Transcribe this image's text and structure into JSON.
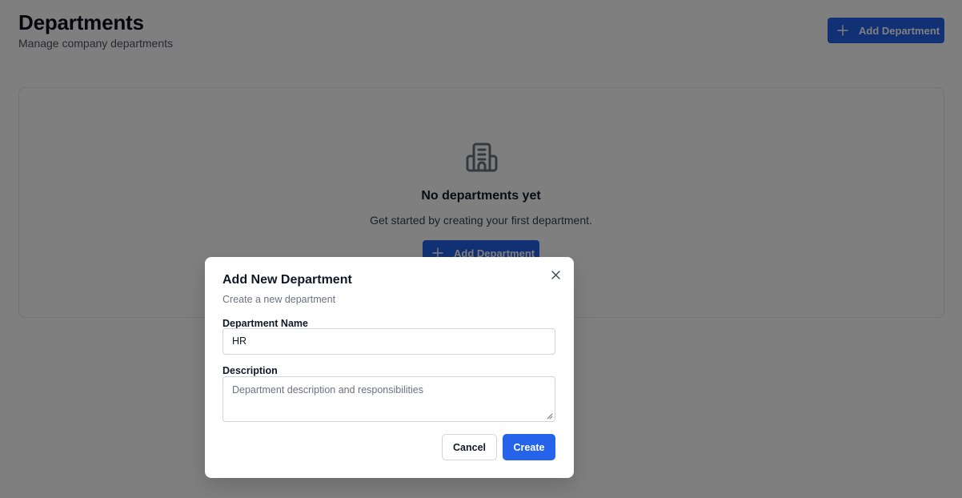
{
  "header": {
    "title": "Departments",
    "subtitle": "Manage company departments",
    "add_button_label": "Add Department"
  },
  "empty_state": {
    "icon": "building-icon",
    "title": "No departments yet",
    "description": "Get started by creating your first department.",
    "add_button_label": "Add Department"
  },
  "dialog": {
    "title": "Add New Department",
    "description": "Create a new department",
    "close_icon": "close-icon",
    "fields": {
      "name": {
        "label": "Department Name",
        "value": "HR"
      },
      "description": {
        "label": "Description",
        "placeholder": "Department description and responsibilities",
        "value": ""
      }
    },
    "cancel_label": "Cancel",
    "create_label": "Create"
  },
  "colors": {
    "primary": "#2563eb",
    "overlay": "rgba(0,0,0,0.5)"
  }
}
